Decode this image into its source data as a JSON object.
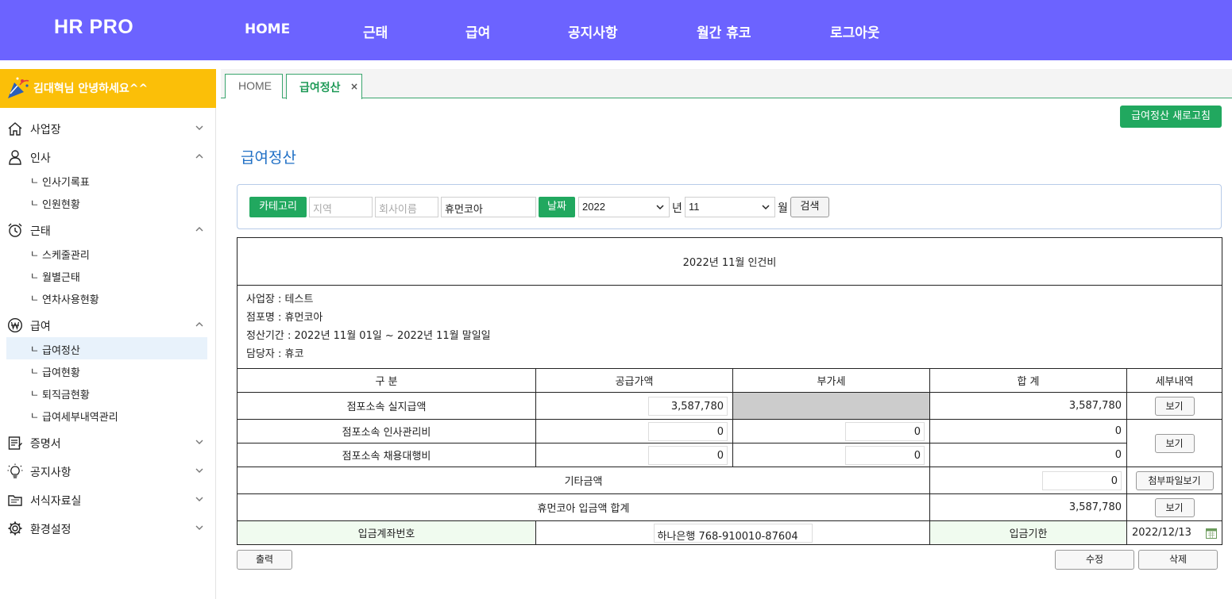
{
  "brand": "HR PRO",
  "nav": [
    "HOME",
    "근태",
    "급여",
    "공지사항",
    "월간 휴코",
    "로그아웃"
  ],
  "greeting": "김대혁님 안녕하세요^^",
  "sidebar": {
    "menus": [
      {
        "label": "사업장",
        "icon": "home-icon",
        "expanded": false
      },
      {
        "label": "인사",
        "icon": "person-icon",
        "expanded": true
      },
      {
        "label": "근태",
        "icon": "alarm-clock-icon",
        "expanded": true
      },
      {
        "label": "급여",
        "icon": "won-icon",
        "expanded": true
      },
      {
        "label": "증명서",
        "icon": "certificate-icon",
        "expanded": false
      },
      {
        "label": "공지사항",
        "icon": "lightbulb-icon",
        "expanded": false
      },
      {
        "label": "서식자료실",
        "icon": "folder-icon",
        "expanded": false
      },
      {
        "label": "환경설정",
        "icon": "gear-icon",
        "expanded": false
      }
    ],
    "sub_mark": "ㄴ",
    "hr_subs": [
      "인사기록표",
      "인원현황"
    ],
    "attendance_subs": [
      "스케줄관리",
      "월별근태",
      "연차사용현황"
    ],
    "pay_subs": [
      "급여정산",
      "급여현황",
      "퇴직금현황",
      "급여세부내역관리"
    ],
    "active_sub": "급여정산"
  },
  "tabs": [
    {
      "label": "HOME",
      "active": false
    },
    {
      "label": "급여정산",
      "active": true,
      "close": "×"
    }
  ],
  "refresh_button": "급여정산 새로고침",
  "page_title": "급여정산",
  "search": {
    "category_label": "카테고리",
    "region_placeholder": "지역",
    "company_placeholder": "회사이름",
    "store_value": "휴먼코아",
    "date_label": "날짜",
    "year_value": "2022",
    "year_unit": "년",
    "month_value": "11",
    "month_unit": "월",
    "search_button": "검색"
  },
  "report": {
    "title": "2022년 11월 인건비",
    "info": [
      "사업장 : 테스트",
      "점포명 : 휴먼코아",
      "정산기간 : 2022년 11월 01일 ~ 2022년 11월 말일일",
      "담당자 : 휴코"
    ],
    "headers": [
      "구 분",
      "공급가액",
      "부가세",
      "합 계",
      "세부내역"
    ],
    "rows": [
      {
        "label": "점포소속 실지급액",
        "supply": "3,587,780",
        "total": "3,587,780"
      },
      {
        "label": "점포소속 인사관리비",
        "supply": "0",
        "vat": "0",
        "total": "0"
      },
      {
        "label": "점포소속 채용대행비",
        "supply": "0",
        "vat": "0",
        "total": "0"
      }
    ],
    "view_button": "보기",
    "other_label": "기타금액",
    "other_value": "0",
    "attach_button": "첨부파일보기",
    "sum_label": "휴먼코아 입금액 합계",
    "sum_value": "3,587,780",
    "account_label": "입금계좌번호",
    "account_value": "하나은행 768-910010-87604",
    "due_label": "입금기한",
    "due_value": "2022/12/13"
  },
  "buttons": {
    "print": "출력",
    "edit": "수정",
    "delete": "삭제"
  },
  "colors": {
    "header": "#6c63ff",
    "greeting": "#fbbf08",
    "accent_green": "#21a85f",
    "title_blue": "#1f6fc5",
    "pale_green": "#f0fbef",
    "disabled_gray": "#cccccc"
  }
}
